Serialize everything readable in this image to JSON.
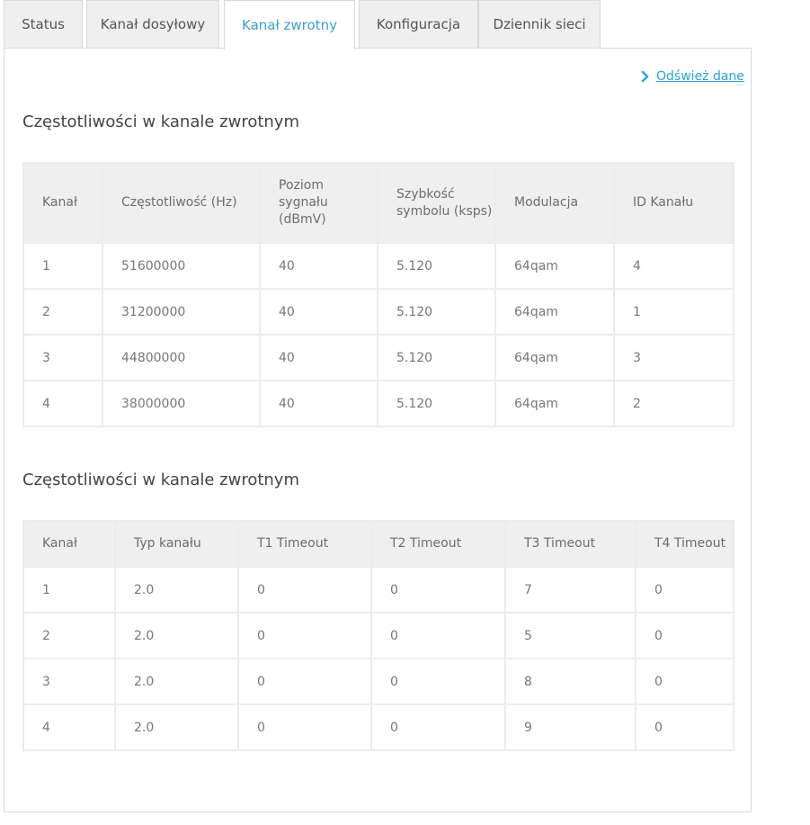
{
  "tabs": [
    {
      "label": "Status",
      "active": false
    },
    {
      "label": "Kanał dosyłowy",
      "active": false
    },
    {
      "label": "Kanał zwrotny",
      "active": true
    },
    {
      "label": "Konfiguracja",
      "active": false
    },
    {
      "label": "Dziennik sieci",
      "active": false
    }
  ],
  "refresh": {
    "label": "Odśwież dane",
    "icon": "chevron-right-icon",
    "color": "#2aa3d6"
  },
  "accent_color": "#3a9fd5",
  "section1": {
    "title": "Częstotliwości w kanale zwrotnym",
    "headers": [
      "Kanał",
      "Częstotliwość (Hz)",
      "Poziom sygnału (dBmV)",
      "Szybkość symbolu (ksps)",
      "Modulacja",
      "ID Kanału"
    ],
    "rows": [
      [
        "1",
        "51600000",
        "40",
        "5.120",
        "64qam",
        "4"
      ],
      [
        "2",
        "31200000",
        "40",
        "5.120",
        "64qam",
        "1"
      ],
      [
        "3",
        "44800000",
        "40",
        "5.120",
        "64qam",
        "3"
      ],
      [
        "4",
        "38000000",
        "40",
        "5.120",
        "64qam",
        "2"
      ]
    ]
  },
  "section2": {
    "title": "Częstotliwości w kanale zwrotnym",
    "headers": [
      "Kanał",
      "Typ kanału",
      "T1 Timeout",
      "T2 Timeout",
      "T3 Timeout",
      "T4 Timeout"
    ],
    "rows": [
      [
        "1",
        "2.0",
        "0",
        "0",
        "7",
        "0"
      ],
      [
        "2",
        "2.0",
        "0",
        "0",
        "5",
        "0"
      ],
      [
        "3",
        "2.0",
        "0",
        "0",
        "8",
        "0"
      ],
      [
        "4",
        "2.0",
        "0",
        "0",
        "9",
        "0"
      ]
    ]
  }
}
